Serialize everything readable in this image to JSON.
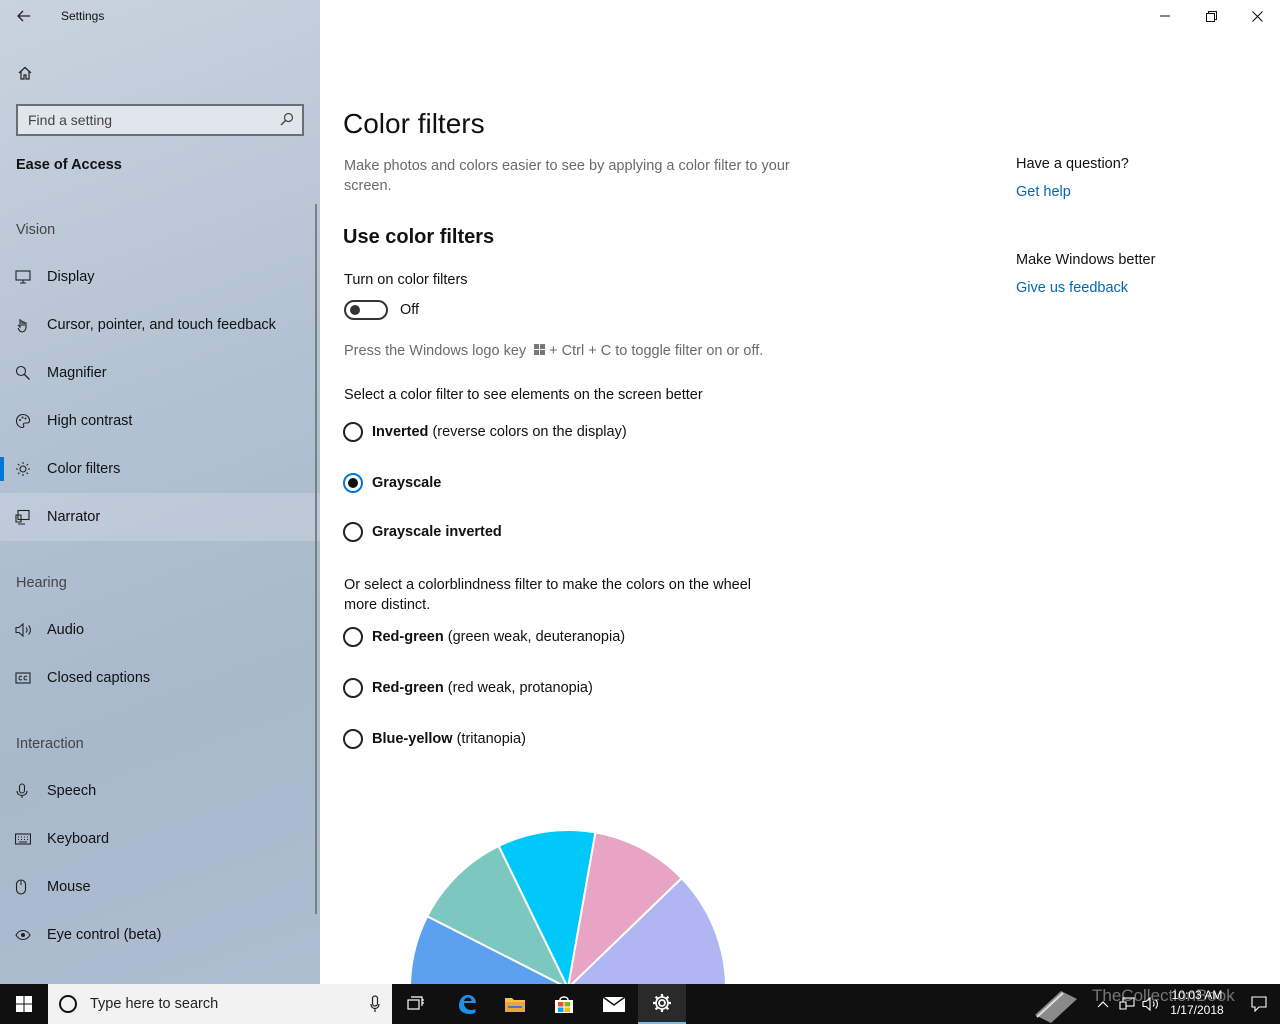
{
  "window": {
    "title": "Settings"
  },
  "sidebar": {
    "search_placeholder": "Find a setting",
    "section": "Ease of Access",
    "groups": [
      {
        "label": "Vision",
        "items": [
          {
            "label": "Display",
            "icon": "display-icon"
          },
          {
            "label": "Cursor, pointer, and touch feedback",
            "icon": "cursor-icon"
          },
          {
            "label": "Magnifier",
            "icon": "magnifier-icon"
          },
          {
            "label": "High contrast",
            "icon": "palette-icon"
          },
          {
            "label": "Color filters",
            "icon": "sun-icon",
            "selected": true
          },
          {
            "label": "Narrator",
            "icon": "narrator-icon"
          }
        ]
      },
      {
        "label": "Hearing",
        "items": [
          {
            "label": "Audio",
            "icon": "speaker-icon"
          },
          {
            "label": "Closed captions",
            "icon": "cc-icon"
          }
        ]
      },
      {
        "label": "Interaction",
        "items": [
          {
            "label": "Speech",
            "icon": "microphone-icon"
          },
          {
            "label": "Keyboard",
            "icon": "keyboard-icon"
          },
          {
            "label": "Mouse",
            "icon": "mouse-icon"
          },
          {
            "label": "Eye control (beta)",
            "icon": "eye-icon"
          }
        ]
      }
    ]
  },
  "main": {
    "title": "Color filters",
    "description": "Make photos and colors easier to see by applying a color filter to your screen.",
    "subheading": "Use color filters",
    "toggle_label": "Turn on color filters",
    "toggle_state": "Off",
    "toggle_on": false,
    "hint_before": "Press the Windows logo key",
    "hint_after": "+ Ctrl + C to toggle filter on or off.",
    "select_prompt": "Select a color filter to see elements on the screen better",
    "filters": [
      {
        "bold": "Inverted",
        "rest": " (reverse colors on the display)",
        "checked": false
      },
      {
        "bold": "Grayscale",
        "rest": "",
        "checked": true
      },
      {
        "bold": "Grayscale inverted",
        "rest": "",
        "checked": false
      }
    ],
    "colorblind_prompt": "Or select a colorblindness filter to make the colors on the wheel more distinct.",
    "colorblind_filters": [
      {
        "bold": "Red-green",
        "rest": " (green weak, deuteranopia)",
        "checked": false
      },
      {
        "bold": "Red-green",
        "rest": " (red weak, protanopia)",
        "checked": false
      },
      {
        "bold": "Blue-yellow",
        "rest": " (tritanopia)",
        "checked": false
      }
    ],
    "wheel_colors": [
      "#5ca0f0",
      "#7cc8c0",
      "#00c8f8",
      "#e8a4c4",
      "#b0b6f2"
    ]
  },
  "right": {
    "question_heading": "Have a question?",
    "get_help": "Get help",
    "better_heading": "Make Windows better",
    "feedback": "Give us feedback"
  },
  "taskbar": {
    "search_placeholder": "Type here to search",
    "time": "10:03 AM",
    "date": "1/17/2018",
    "watermark": "TheCollectionBook"
  },
  "colors": {
    "accent": "#0078d7",
    "link": "#0067b8",
    "taskbar": "#101010"
  }
}
